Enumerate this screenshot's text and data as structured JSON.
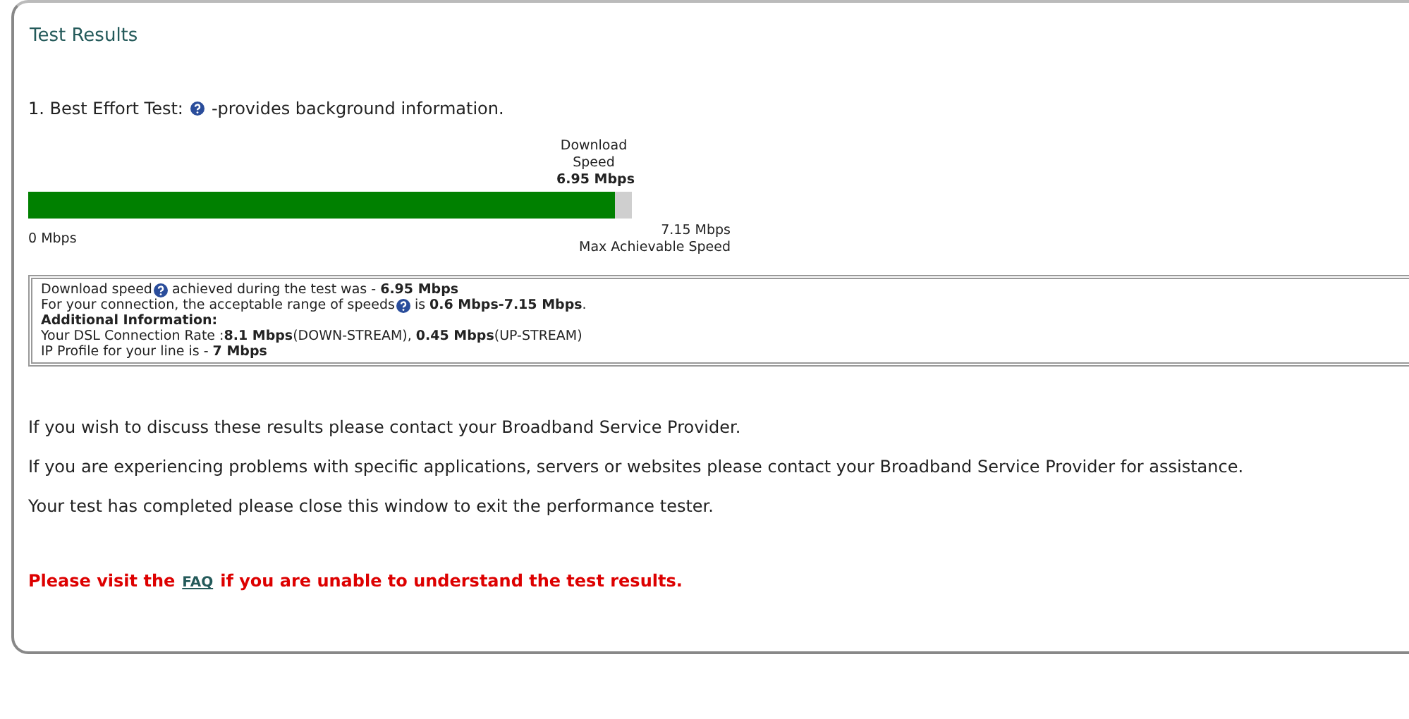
{
  "title": "Test Results",
  "test": {
    "heading": [
      {
        "kind": "text",
        "text": "1. Best Effort Test:"
      },
      {
        "kind": "help"
      },
      {
        "kind": "text",
        "text": "-provides background information."
      }
    ],
    "meter": {
      "label": "Download Speed",
      "value": "6.95 Mbps",
      "level": 0.972,
      "min": "0 Mbps",
      "max": "7.15 Mbps",
      "max_caption": "Max Achievable Speed"
    }
  },
  "info_lines": [
    [
      {
        "kind": "text",
        "text": "Download speed"
      },
      {
        "kind": "help"
      },
      {
        "kind": "text",
        "text": "achieved during the test was - **6.95 Mbps**"
      }
    ],
    [
      {
        "kind": "text",
        "text": "For your connection, the acceptable range of speeds"
      },
      {
        "kind": "help"
      },
      {
        "kind": "text",
        "text": "is **0.6 Mbps-7.15 Mbps**."
      }
    ],
    [
      {
        "kind": "bold",
        "text": "Additional Information:"
      }
    ],
    [
      {
        "kind": "text",
        "text": "Your DSL Connection Rate :**8.1 Mbps**(DOWN-STREAM), **0.45 Mbps**(UP-STREAM)"
      }
    ],
    [
      {
        "kind": "text",
        "text": "IP Profile for your line is - **7 Mbps**"
      }
    ]
  ],
  "messages": [
    "If you wish to discuss these results please contact your Broadband Service Provider.",
    "If you are experiencing problems with specific applications, servers or websites please contact your Broadband Service Provider for assistance.",
    "Your test has completed please close this window to exit the performance tester."
  ],
  "notice": {
    "before": "Please visit the",
    "link": "FAQ",
    "after": "if you are unable to understand the test results."
  }
}
